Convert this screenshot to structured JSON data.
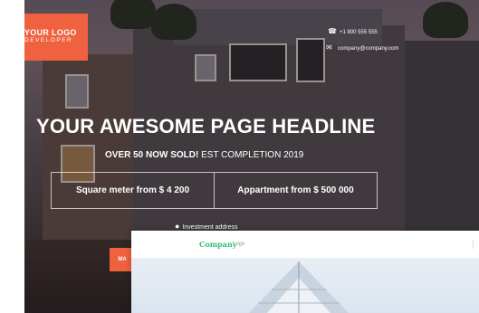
{
  "brand": {
    "logo_title": "YOUR LOGO",
    "logo_subtitle": "DEVELOPER"
  },
  "contact": {
    "phone": "+1 800 555 555",
    "email": "company@company.com",
    "phone_icon": "phone-icon",
    "email_icon": "envelope-icon"
  },
  "hero": {
    "headline": "YOUR AWESOME PAGE HEADLINE",
    "sub_bold": "OVER 50 NOW SOLD!",
    "sub_rest": " EST COMPLETION 2019",
    "prices": [
      "Square meter from $ 4 200",
      "Appartment from $ 500 000"
    ],
    "address": "Investment address",
    "cta_label": "MA"
  },
  "preview_card": {
    "company": "Company",
    "company_suffix": "Logo"
  },
  "colors": {
    "accent": "#f0613f",
    "company_green": "#2fbf71"
  }
}
